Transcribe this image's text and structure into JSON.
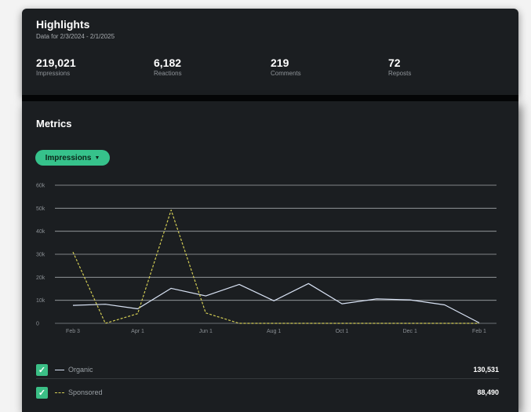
{
  "highlights": {
    "title": "Highlights",
    "subtitle": "Data for 2/3/2024 - 2/1/2025",
    "stats": [
      {
        "value": "219,021",
        "label": "Impressions"
      },
      {
        "value": "6,182",
        "label": "Reactions"
      },
      {
        "value": "219",
        "label": "Comments"
      },
      {
        "value": "72",
        "label": "Reposts"
      }
    ]
  },
  "metrics": {
    "title": "Metrics",
    "dropdown_label": "Impressions",
    "dropdown_icon": "caret-down-icon",
    "legend": [
      {
        "label": "Organic",
        "total": "130,531",
        "checked": true
      },
      {
        "label": "Sponsored",
        "total": "88,490",
        "checked": true
      }
    ]
  },
  "colors": {
    "accent": "#36c28b",
    "organic_line": "#d9e3f5",
    "sponsored_line": "#d2cc54"
  },
  "chart_data": {
    "type": "line",
    "x": [
      "2024-02-03",
      "2024-03-03",
      "2024-04-01",
      "2024-05-01",
      "2024-06-01",
      "2024-07-01",
      "2024-08-01",
      "2024-09-01",
      "2024-10-01",
      "2024-11-01",
      "2024-12-01",
      "2025-01-01",
      "2025-02-01"
    ],
    "x_tick_labels": [
      "Feb 3",
      "Apr 1",
      "Jun 1",
      "Aug 1",
      "Oct 1",
      "Dec 1",
      "Feb 1"
    ],
    "y_tick_labels": [
      "0",
      "10k",
      "20k",
      "30k",
      "40k",
      "50k",
      "60k"
    ],
    "ylim": [
      0,
      60000
    ],
    "grid": true,
    "series": [
      {
        "name": "Organic",
        "values": [
          7800,
          8300,
          6300,
          15200,
          11900,
          16900,
          9800,
          17300,
          8500,
          10600,
          10200,
          8000,
          200
        ]
      },
      {
        "name": "Sponsored",
        "values": [
          31000,
          0,
          4200,
          49200,
          4500,
          0,
          0,
          0,
          0,
          0,
          0,
          0,
          0
        ]
      }
    ]
  }
}
